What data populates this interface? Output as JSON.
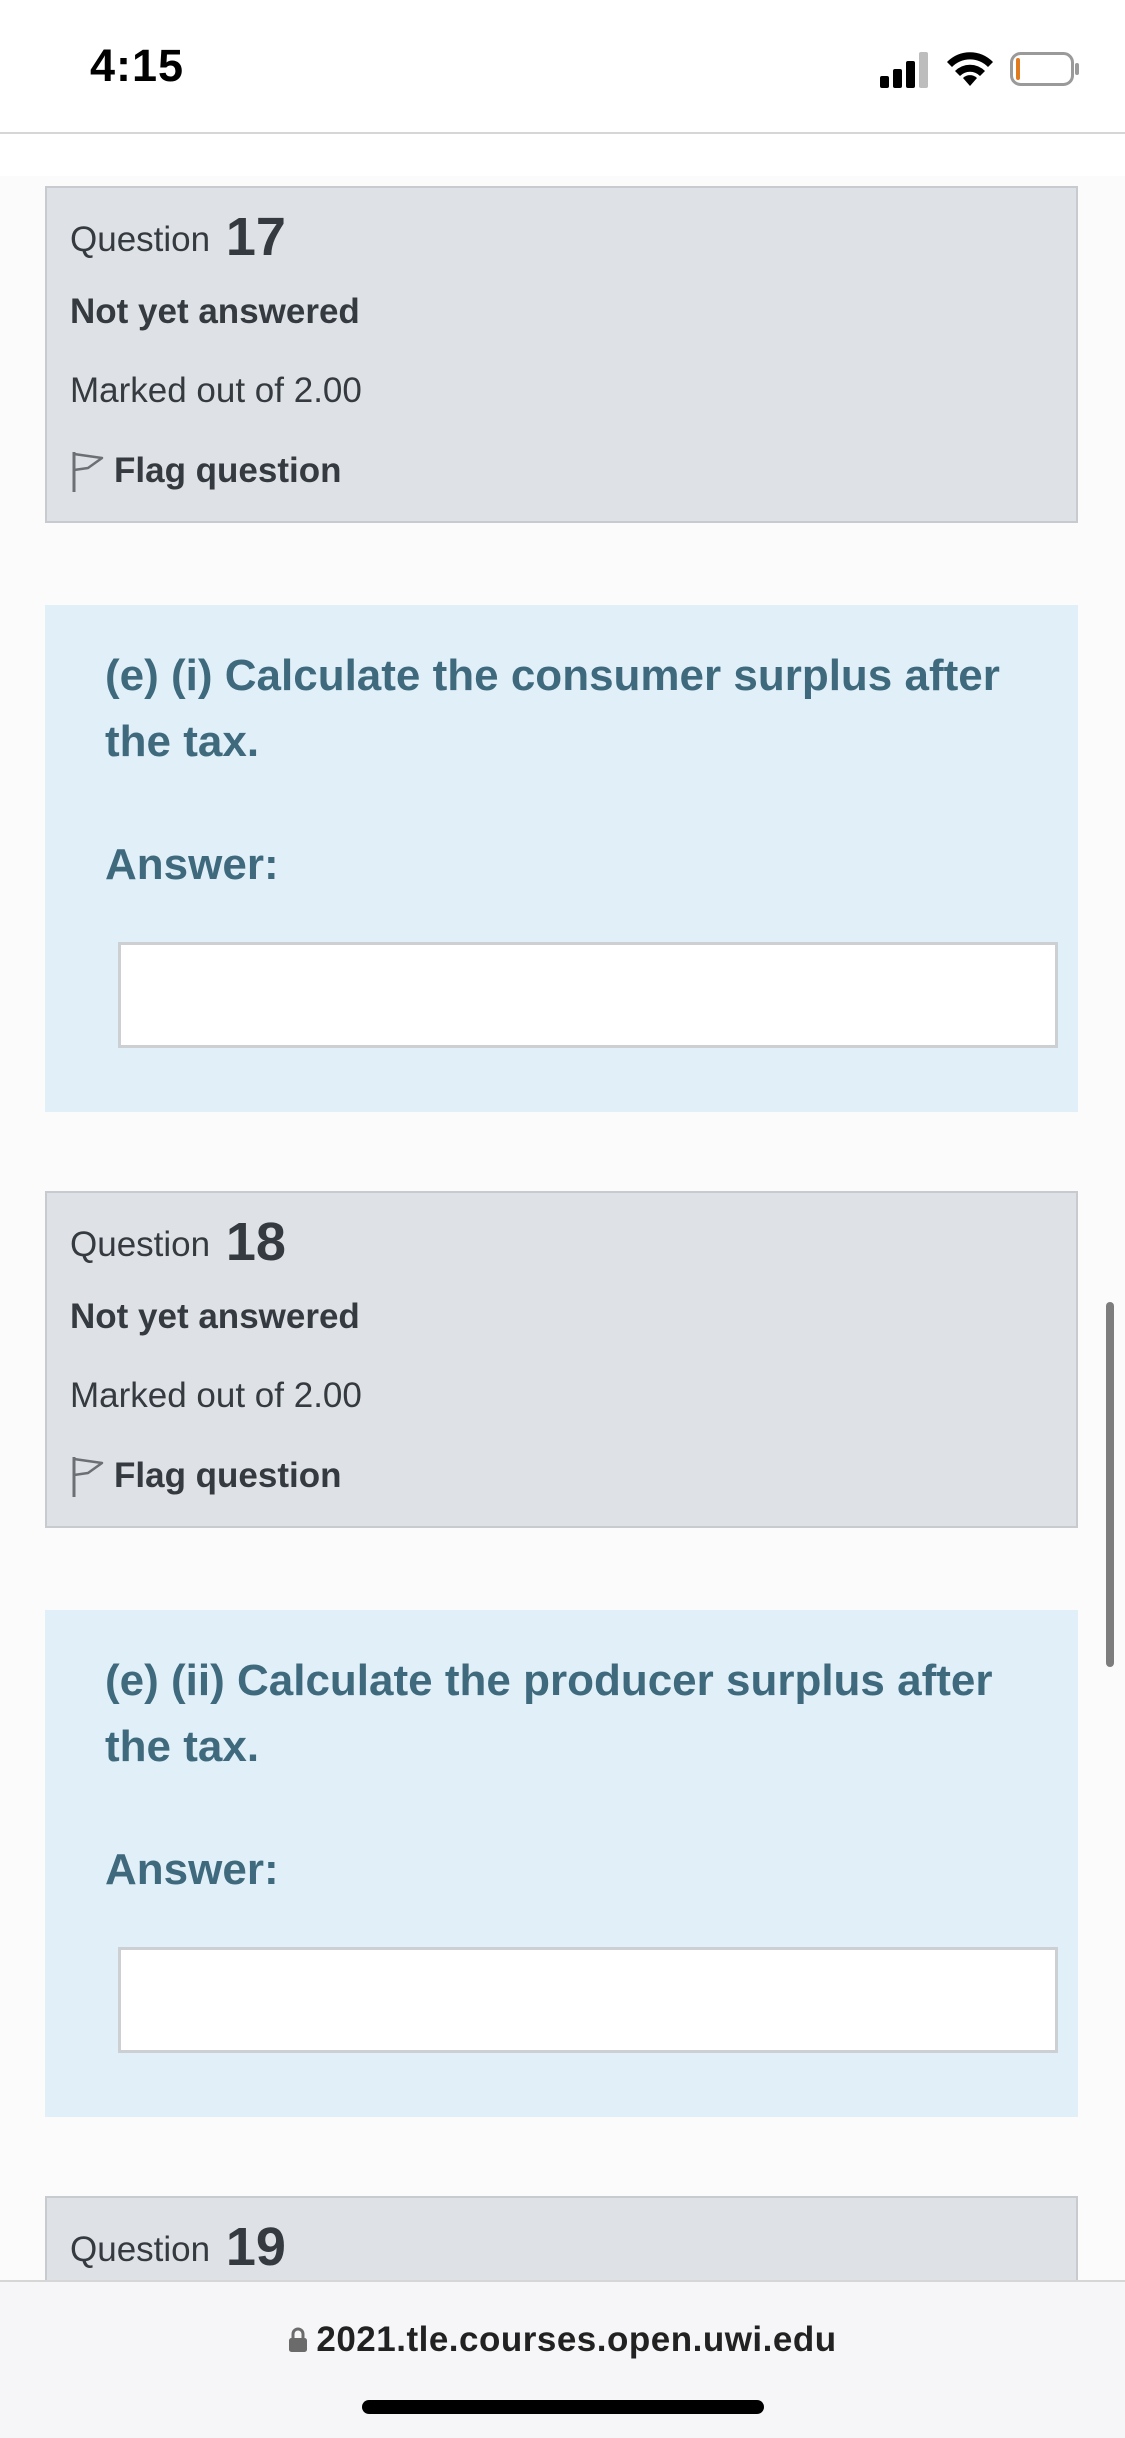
{
  "status_bar": {
    "time": "4:15",
    "icons": [
      "cellular-signal-icon",
      "wifi-icon",
      "battery-icon"
    ]
  },
  "questions": [
    {
      "label": "Question",
      "number": "17",
      "state": "Not yet answered",
      "grade": "Marked out of 2.00",
      "flag_label": "Flag question",
      "text": "(e) (i) Calculate the consumer surplus after the tax.",
      "answer_label": "Answer:",
      "answer_value": ""
    },
    {
      "label": "Question",
      "number": "18",
      "state": "Not yet answered",
      "grade": "Marked out of 2.00",
      "flag_label": "Flag question",
      "text": "(e) (ii) Calculate the producer surplus after the tax.",
      "answer_label": "Answer:",
      "answer_value": ""
    },
    {
      "label": "Question",
      "number": "19"
    }
  ],
  "browser": {
    "url": "2021.tle.courses.open.uwi.edu",
    "icons": [
      "lock-icon"
    ]
  },
  "colors": {
    "info_box_bg": "#dee2e6",
    "content_box_bg": "#e1f0f8",
    "question_text": "#3f6a7d"
  }
}
